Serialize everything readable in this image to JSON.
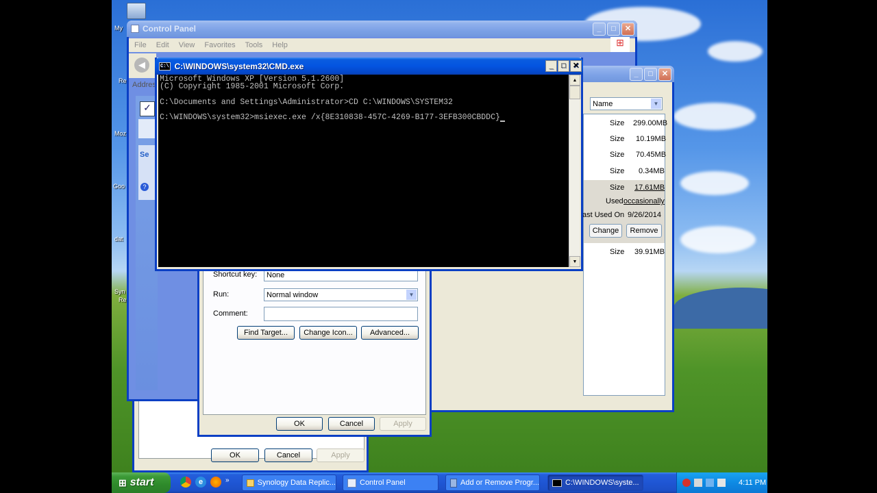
{
  "desktop": {
    "icon_labels": [
      "My",
      "Re",
      "Moz",
      "Goo",
      "dat",
      "Syn",
      "Re"
    ]
  },
  "control_panel": {
    "title": "Control Panel",
    "menu": [
      "File",
      "Edit",
      "View",
      "Favorites",
      "Tools",
      "Help"
    ],
    "address_label": "Addres",
    "side_label": "Se"
  },
  "add_remove": {
    "sort_label": "Name",
    "programs": [
      {
        "label": "Size",
        "value": "299.00MB"
      },
      {
        "label": "Size",
        "value": "10.19MB"
      },
      {
        "label": "Size",
        "value": "70.45MB"
      },
      {
        "label": "Size",
        "value": "0.34MB"
      }
    ],
    "selected": {
      "size_label": "Size",
      "size_value": "17.61MB",
      "used_label": "Used",
      "used_value": "occasionally",
      "last_used_label": "ast Used On",
      "last_used_value": "9/26/2014",
      "change_label": "Change",
      "remove_label": "Remove"
    },
    "after": {
      "label": "Size",
      "value": "39.91MB"
    }
  },
  "shortcut_props": {
    "shortcut_key_label": "Shortcut key:",
    "shortcut_key_value": "None",
    "run_label": "Run:",
    "run_value": "Normal window",
    "comment_label": "Comment:",
    "comment_value": "",
    "find_target": "Find Target...",
    "change_icon": "Change Icon...",
    "advanced": "Advanced...",
    "ok": "OK",
    "cancel": "Cancel",
    "apply": "Apply"
  },
  "back_dialog": {
    "ok": "OK",
    "cancel": "Cancel",
    "apply": "Apply"
  },
  "cmd": {
    "title": "C:\\WINDOWS\\system32\\CMD.exe",
    "icon_text": "C:\\",
    "lines": [
      "Microsoft Windows XP [Version 5.1.2600]",
      "(C) Copyright 1985-2001 Microsoft Corp.",
      "",
      "C:\\Documents and Settings\\Administrator>CD C:\\WINDOWS\\SYSTEM32",
      "",
      "C:\\WINDOWS\\system32>msiexec.exe /x{8E310838-457C-4269-B177-3EFB300CBDDC}"
    ]
  },
  "taskbar": {
    "start": "start",
    "tasks": [
      {
        "label": "Synology Data Replic...",
        "icon": "folder-icon"
      },
      {
        "label": "Control Panel",
        "icon": "control-panel-icon"
      },
      {
        "label": "Add or Remove Progr...",
        "icon": "add-remove-icon"
      },
      {
        "label": "C:\\WINDOWS\\syste...",
        "icon": "cmd-icon"
      }
    ],
    "clock": "4:11 PM"
  }
}
